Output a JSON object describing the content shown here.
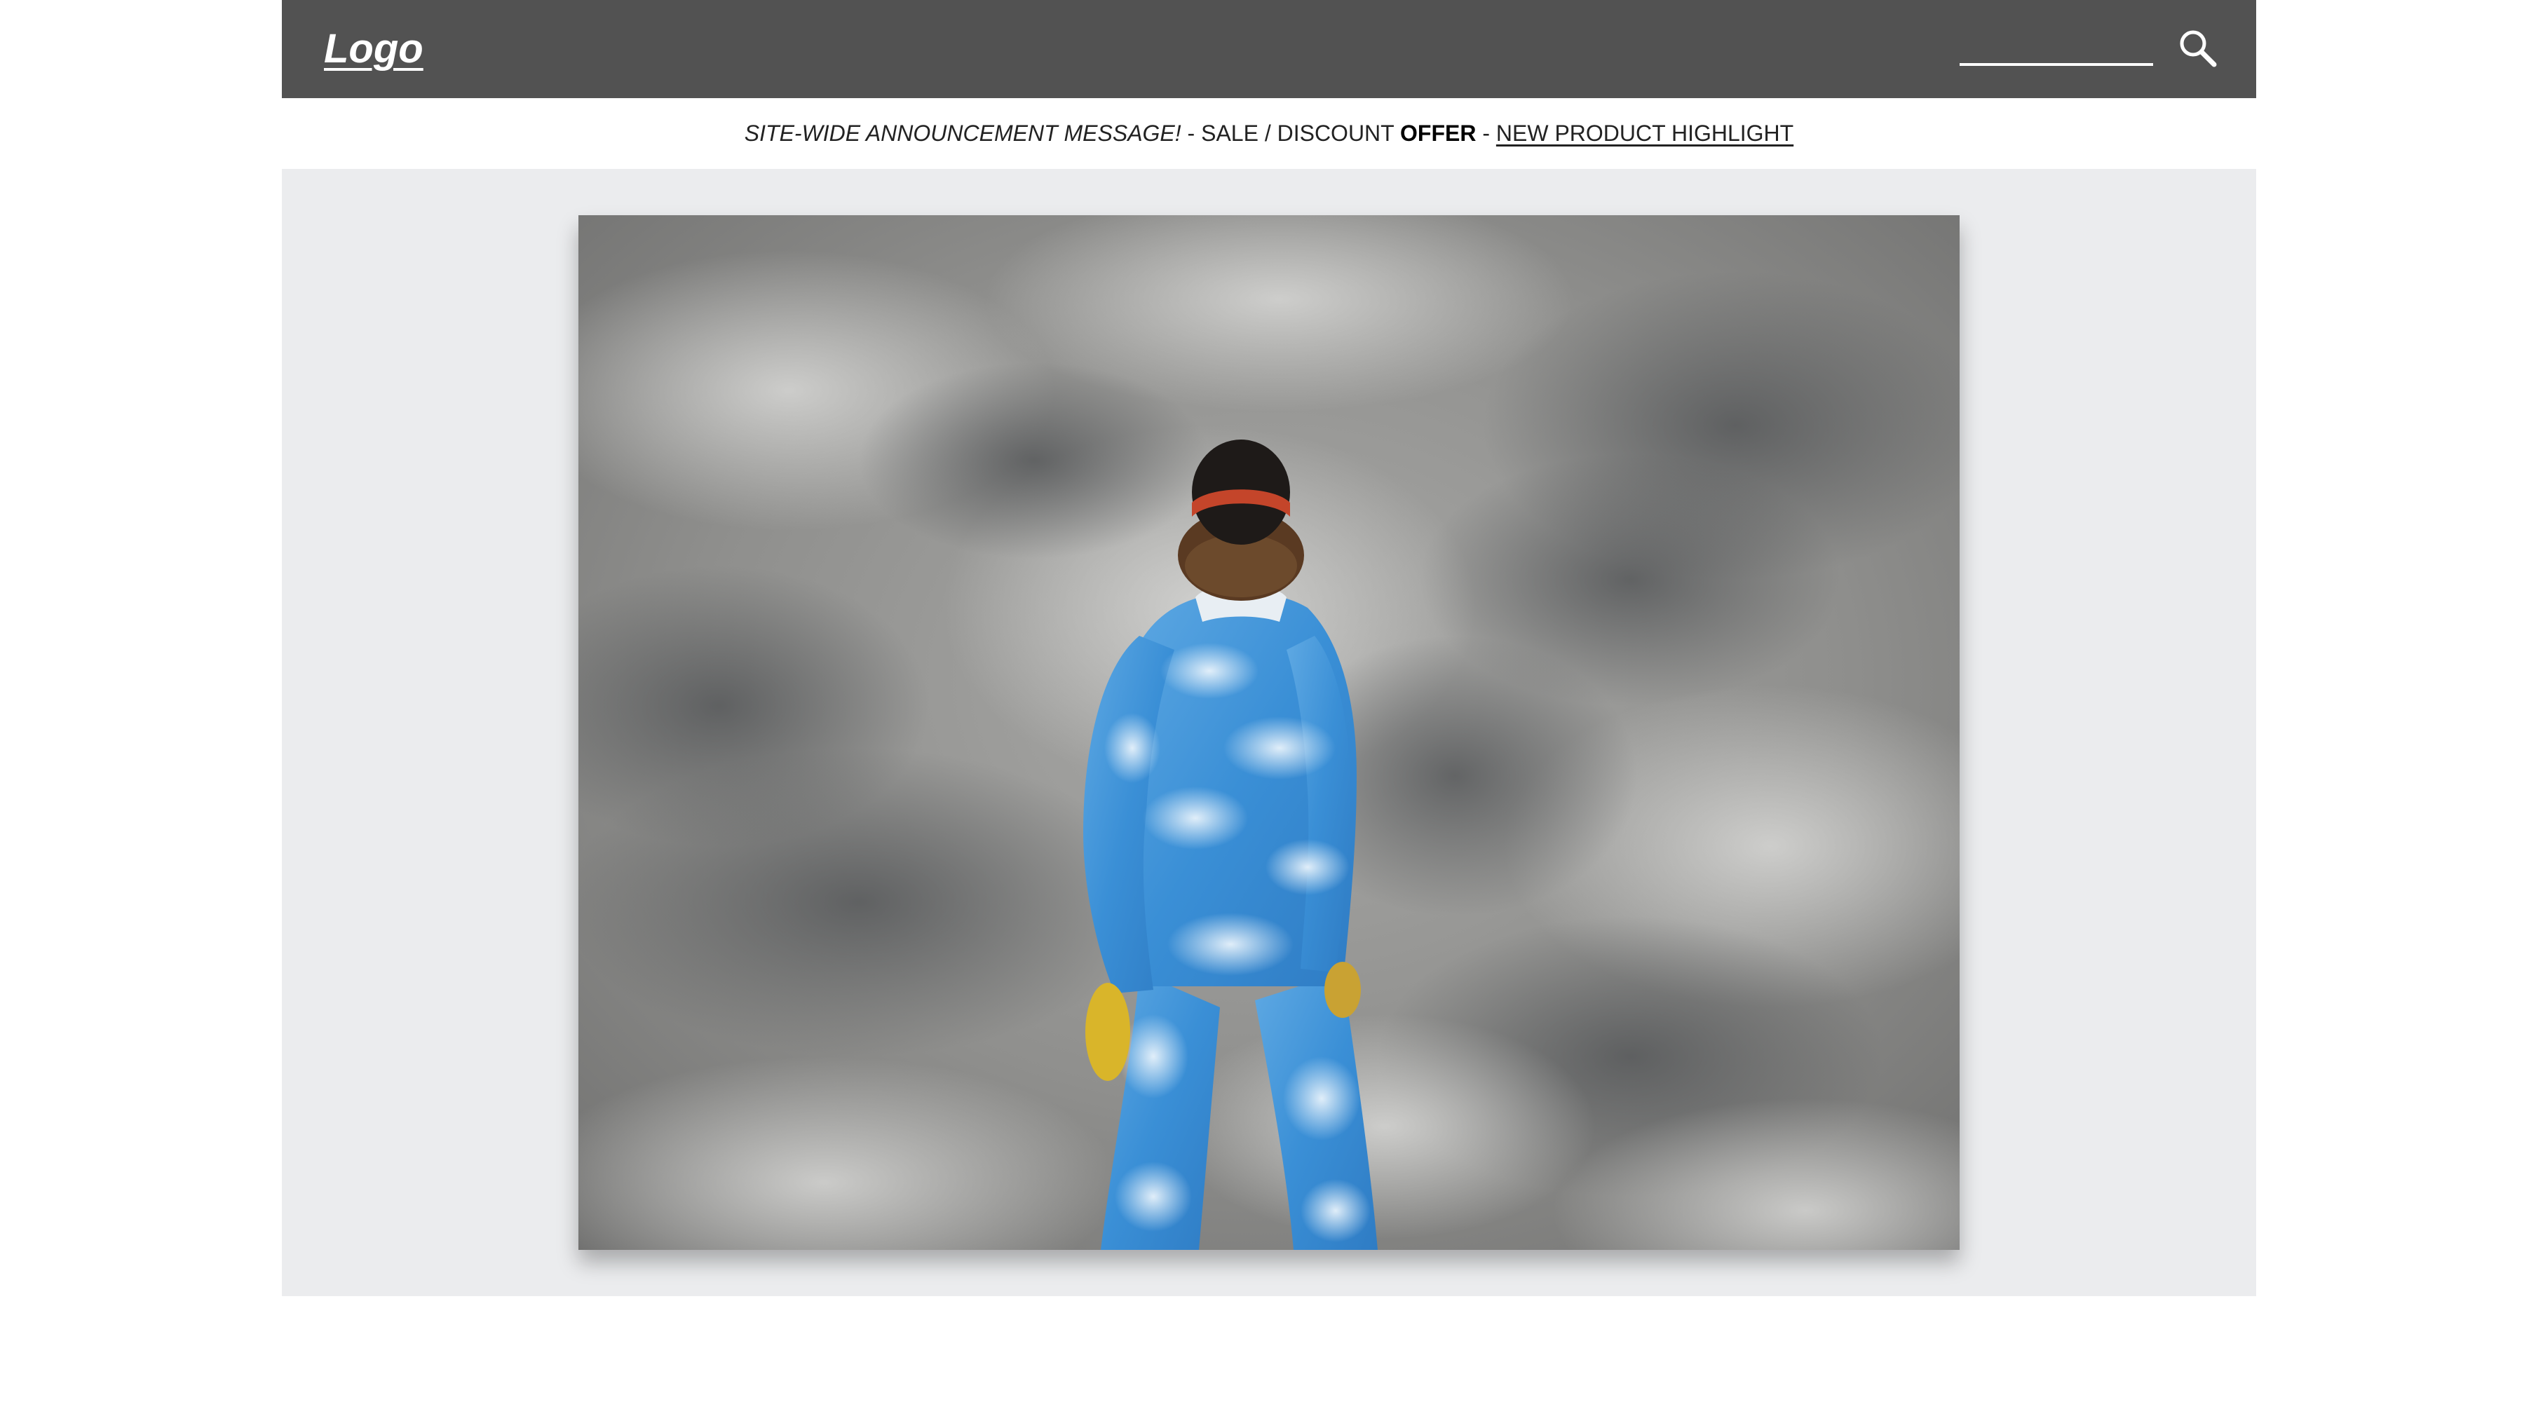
{
  "header": {
    "logo_text": "Logo",
    "search": {
      "value": "",
      "placeholder": ""
    },
    "search_icon": "magnifier-icon"
  },
  "announcement": {
    "message": "SITE-WIDE ANNOUNCEMENT MESSAGE!",
    "separator_1": " - ",
    "sale_text": "SALE / DISCOUNT ",
    "offer_text": "OFFER",
    "separator_2": " - ",
    "highlight_link": "NEW PRODUCT HIGHLIGHT"
  },
  "colors": {
    "header_bg": "#525252",
    "hero_bg": "#ebecee",
    "page_bg": "#ffffff"
  }
}
